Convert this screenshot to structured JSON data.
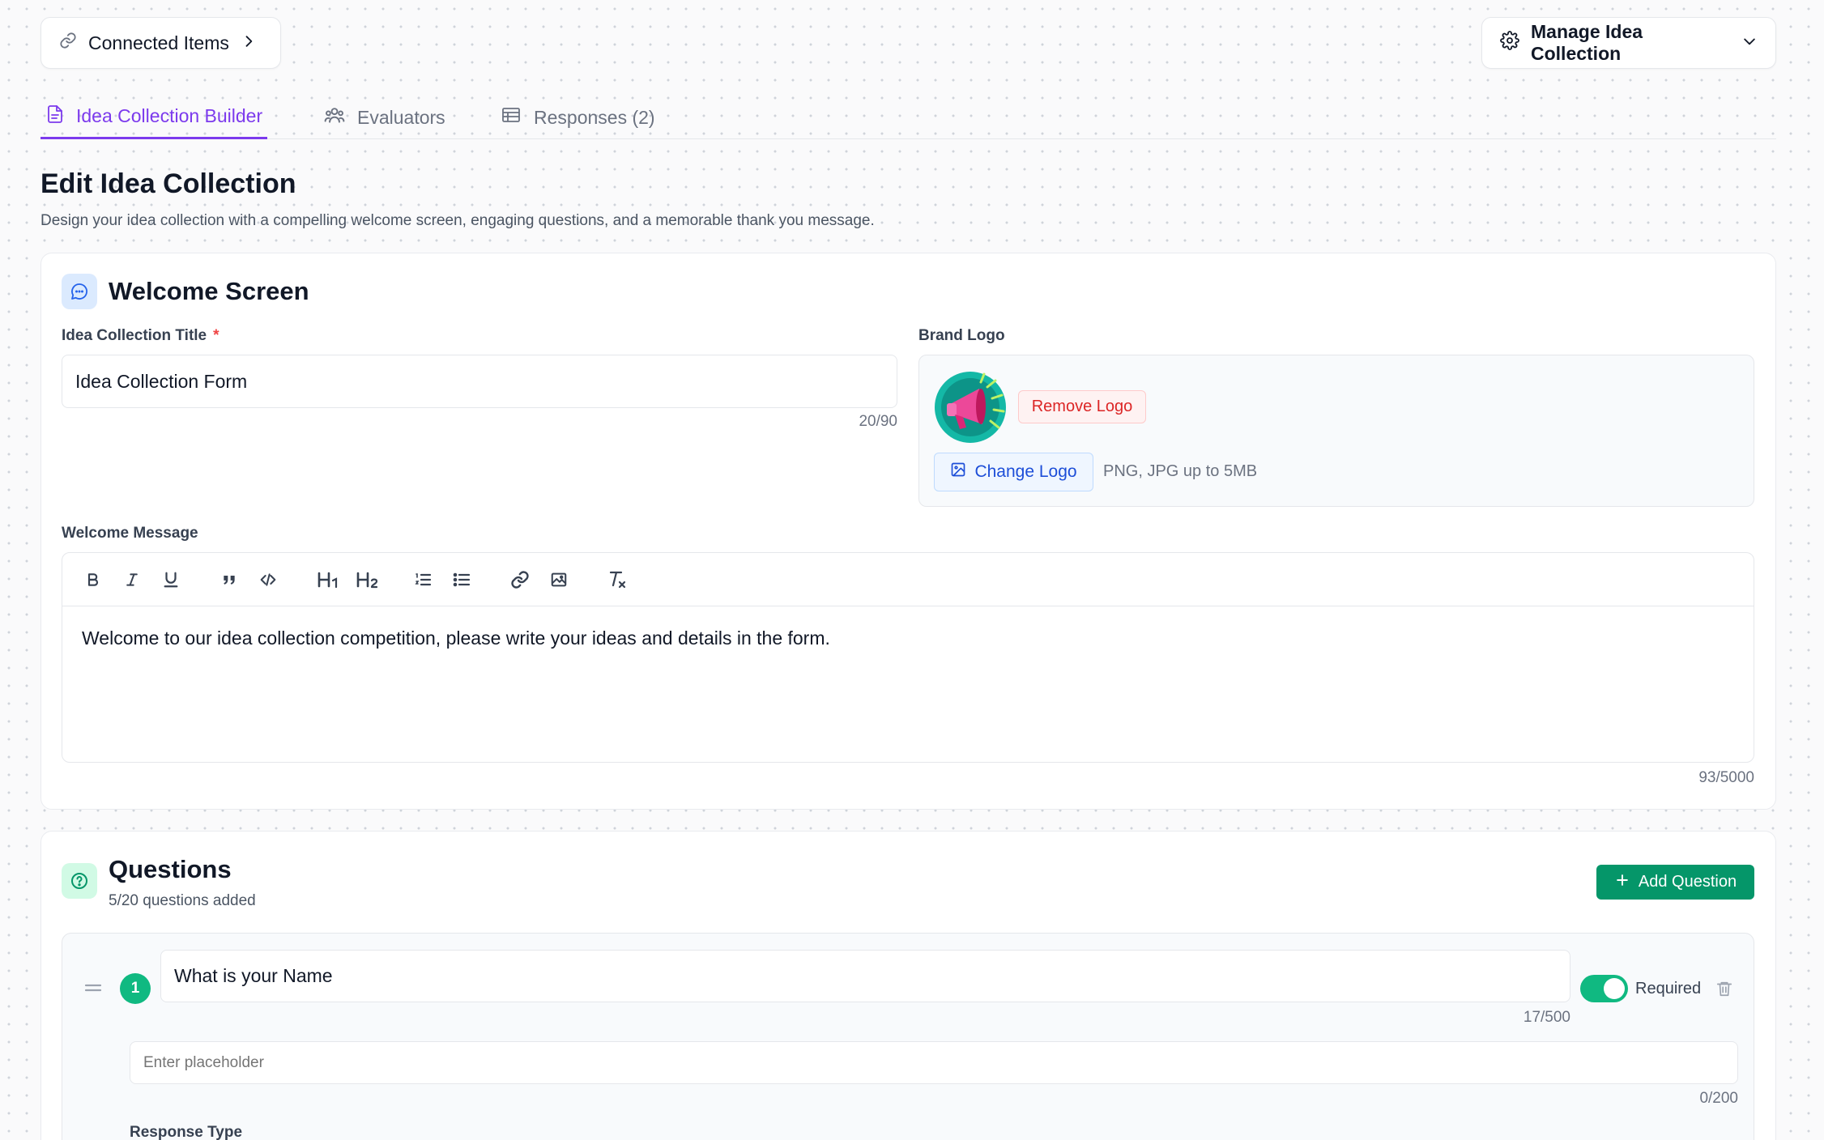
{
  "topbar": {
    "connected_label": "Connected Items",
    "manage_label": "Manage Idea Collection"
  },
  "tabs": [
    {
      "label": "Idea Collection Builder",
      "active": true
    },
    {
      "label": "Evaluators",
      "active": false
    },
    {
      "label": "Responses (2)",
      "active": false
    }
  ],
  "page": {
    "title": "Edit Idea Collection",
    "subtitle": "Design your idea collection with a compelling welcome screen, engaging questions, and a memorable thank you message."
  },
  "welcome": {
    "heading": "Welcome Screen",
    "title_label": "Idea Collection Title",
    "title_required_mark": "*",
    "title_value": "Idea Collection Form",
    "title_counter": "20/90",
    "logo_label": "Brand Logo",
    "remove_logo_label": "Remove Logo",
    "change_logo_label": "Change Logo",
    "logo_hint": "PNG, JPG up to 5MB",
    "message_label": "Welcome Message",
    "message_text": "Welcome to our idea collection competition, please write your ideas and details in the form.",
    "message_counter": "93/5000",
    "toolbar_icons": [
      "bold-icon",
      "italic-icon",
      "underline-icon",
      "quote-icon",
      "code-icon",
      "heading1-icon",
      "heading2-icon",
      "ordered-list-icon",
      "bullet-list-icon",
      "link-icon",
      "image-icon",
      "clear-format-icon"
    ]
  },
  "questions": {
    "heading": "Questions",
    "count_text": "5/20 questions added",
    "add_label": "Add Question",
    "items": [
      {
        "number": "1",
        "text": "What is your Name",
        "text_counter": "17/500",
        "required_label": "Required",
        "required": true,
        "placeholder_hint": "Enter placeholder",
        "placeholder_counter": "0/200",
        "response_type_label": "Response Type"
      }
    ]
  },
  "colors": {
    "accent_purple": "#7c3aed",
    "success_green": "#059669",
    "danger_red": "#dc2626",
    "link_blue": "#1d4ed8"
  }
}
